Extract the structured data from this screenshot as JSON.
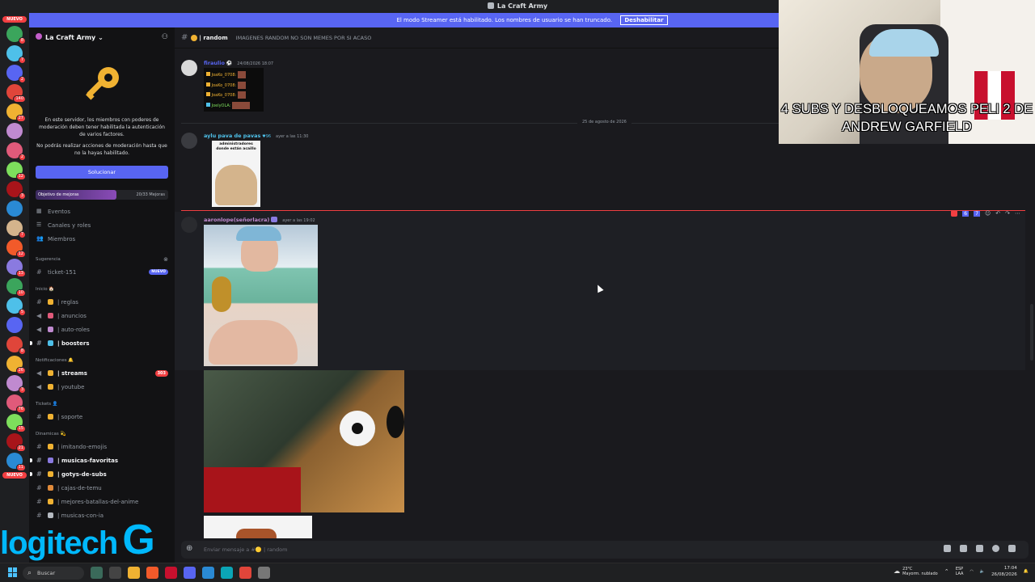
{
  "window": {
    "title": "La Craft Army"
  },
  "streamer_banner": {
    "text": "El modo Streamer está habilitado. Los nombres de usuario se han truncado.",
    "button": "Deshabilitar"
  },
  "guild_bar": {
    "new_label": "NUEVO",
    "badges": [
      "8",
      "7",
      "2",
      "140",
      "27",
      "",
      "2",
      "12",
      "3",
      "",
      "7",
      "12",
      "13",
      "10",
      "5",
      "",
      "8",
      "26",
      "3",
      "76",
      "15",
      "21",
      "11"
    ],
    "bottom_label": "NUEVO"
  },
  "server": {
    "name": "La Craft Army",
    "mfa_text_1": "En este servidor, los miembros con poderes de moderación deben tener habilitada la autenticación de varios factores.",
    "mfa_text_2": "No podrás realizar acciones de moderación hasta que no la hayas habilitado.",
    "fix_button": "Solucionar",
    "boost_goal": {
      "label": "Objetivo de mejoras",
      "progress": "20/33 Mejoras",
      "fraction": 0.61
    }
  },
  "nav": [
    {
      "label": "Eventos"
    },
    {
      "label": "Canales y roles"
    },
    {
      "label": "Miembros"
    }
  ],
  "categories": {
    "sugerencia": "Sugerencia",
    "inicio": "Inicio 🏠",
    "notificaciones": "Notificaciones 🔔",
    "tickets": "Tickets 👤",
    "dinamicas": "Dinamicas 💫"
  },
  "channels": {
    "ticket": {
      "name": "ticket-151",
      "pill": "NUEVO"
    },
    "reglas": "| reglas",
    "anuncios": "| anuncios",
    "autoroles": "| auto-roles",
    "boosters": "| boosters",
    "streams": {
      "name": "| streams",
      "count": "303"
    },
    "youtube": "| youtube",
    "soporte": "| soporte",
    "imitando": "| imitando-emojis",
    "musicas": "| musicas-favoritas",
    "gotys": "| gotys-de-subs",
    "cajas": "| cajas-de-temu",
    "batallas": "| mejores-batallas-del-anime",
    "musicas_ia": "| musicas-con-ia"
  },
  "chat": {
    "channel_name": "| random",
    "topic": "IMAGENES RANDOM NO SON MEMES POR SI ACASO",
    "composer_placeholder": "Enviar mensaje a #🟡 | random",
    "date_divider": "25 de agosto de 2026",
    "messages": [
      {
        "user": "firaulio",
        "timestamp": "24/08/2026 18:07",
        "lines": [
          "JoaKo_0708:",
          "JoaKo_0708:",
          "JoaKo_0708:",
          "JoelyOLA:"
        ]
      },
      {
        "user": "aylu pava de pavas",
        "badge": "96",
        "timestamp": "ayer a las 11:30",
        "image_caption": "administradores donde están acaillo"
      },
      {
        "user": "aaronlope(señorlacra)",
        "timestamp": "ayer a las 19:02",
        "tool_counts": [
          "6",
          "7"
        ]
      }
    ]
  },
  "webcam": {
    "caption": "4 SUBS Y DESBLOQUEAMOS PELI 2 DE ANDREW GARFIELD"
  },
  "overlay": {
    "logo_text": "logitech"
  },
  "taskbar": {
    "search": "Buscar",
    "weather_temp": "23°C",
    "weather_desc": "Mayorm. nublado",
    "lang": "ESP",
    "lang2": "LAA",
    "time": "17:04",
    "date": "26/08/2026"
  },
  "colors": {
    "accent": "#5865f2",
    "danger": "#f23f42",
    "logitech": "#00b8fc"
  }
}
